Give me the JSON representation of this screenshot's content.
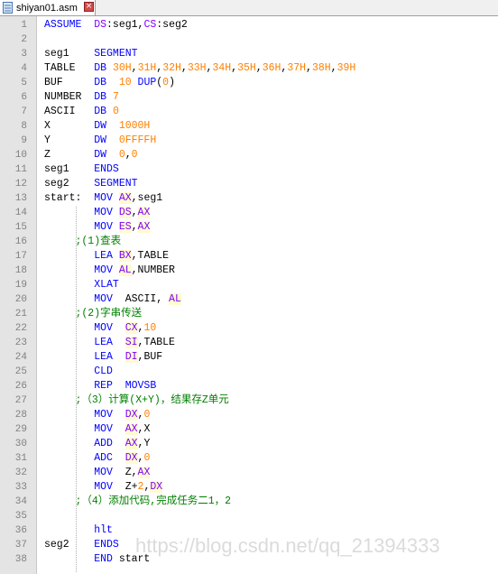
{
  "tab": {
    "filename": "shiyan01.asm",
    "close_glyph": "×"
  },
  "colors": {
    "keyword": "#0000ff",
    "register": "#8000ff",
    "number": "#ff8000",
    "comment": "#008000",
    "gutter": "#e4e4e4"
  },
  "lines": [
    [
      [
        "ASSUME  ",
        "kw"
      ],
      [
        "DS",
        "reg"
      ],
      [
        ":seg1,",
        ""
      ],
      [
        "CS",
        "reg"
      ],
      [
        ":seg2",
        ""
      ]
    ],
    [],
    [
      [
        "seg1    ",
        ""
      ],
      [
        "SEGMENT",
        "kw"
      ]
    ],
    [
      [
        "TABLE   ",
        ""
      ],
      [
        "DB ",
        "kw"
      ],
      [
        "30H",
        "num"
      ],
      [
        ",",
        ""
      ],
      [
        "31H",
        "num"
      ],
      [
        ",",
        ""
      ],
      [
        "32H",
        "num"
      ],
      [
        ",",
        ""
      ],
      [
        "33H",
        "num"
      ],
      [
        ",",
        ""
      ],
      [
        "34H",
        "num"
      ],
      [
        ",",
        ""
      ],
      [
        "35H",
        "num"
      ],
      [
        ",",
        ""
      ],
      [
        "36H",
        "num"
      ],
      [
        ",",
        ""
      ],
      [
        "37H",
        "num"
      ],
      [
        ",",
        ""
      ],
      [
        "38H",
        "num"
      ],
      [
        ",",
        ""
      ],
      [
        "39H",
        "num"
      ]
    ],
    [
      [
        "BUF     ",
        ""
      ],
      [
        "DB  ",
        "kw"
      ],
      [
        "10 ",
        "num"
      ],
      [
        "DUP",
        "kw"
      ],
      [
        "(",
        ""
      ],
      [
        "0",
        "num"
      ],
      [
        ")",
        ""
      ]
    ],
    [
      [
        "NUMBER  ",
        ""
      ],
      [
        "DB ",
        "kw"
      ],
      [
        "7",
        "num"
      ]
    ],
    [
      [
        "ASCII   ",
        ""
      ],
      [
        "DB ",
        "kw"
      ],
      [
        "0",
        "num"
      ]
    ],
    [
      [
        "X       ",
        ""
      ],
      [
        "DW  ",
        "kw"
      ],
      [
        "1000H",
        "num"
      ]
    ],
    [
      [
        "Y       ",
        ""
      ],
      [
        "DW  ",
        "kw"
      ],
      [
        "0FFFFH",
        "num"
      ]
    ],
    [
      [
        "Z       ",
        ""
      ],
      [
        "DW  ",
        "kw"
      ],
      [
        "0",
        "num"
      ],
      [
        ",",
        ""
      ],
      [
        "0",
        "num"
      ]
    ],
    [
      [
        "seg1    ",
        ""
      ],
      [
        "ENDS",
        "kw"
      ]
    ],
    [
      [
        "seg2    ",
        ""
      ],
      [
        "SEGMENT",
        "kw"
      ]
    ],
    [
      [
        "start:  ",
        ""
      ],
      [
        "MOV ",
        "kw"
      ],
      [
        "AX",
        "reg"
      ],
      [
        ",seg1",
        ""
      ]
    ],
    [
      [
        "        ",
        ""
      ],
      [
        "MOV ",
        "kw"
      ],
      [
        "DS",
        "reg"
      ],
      [
        ",",
        ""
      ],
      [
        "AX",
        "reg"
      ]
    ],
    [
      [
        "        ",
        ""
      ],
      [
        "MOV ",
        "kw"
      ],
      [
        "ES",
        "reg"
      ],
      [
        ",",
        ""
      ],
      [
        "AX",
        "reg"
      ]
    ],
    [
      [
        "     ;(1)查表",
        "cmt"
      ]
    ],
    [
      [
        "        ",
        ""
      ],
      [
        "LEA ",
        "kw"
      ],
      [
        "BX",
        "reg"
      ],
      [
        ",TABLE",
        ""
      ]
    ],
    [
      [
        "        ",
        ""
      ],
      [
        "MOV ",
        "kw"
      ],
      [
        "AL",
        "reg"
      ],
      [
        ",NUMBER",
        ""
      ]
    ],
    [
      [
        "        ",
        ""
      ],
      [
        "XLAT",
        "kw"
      ]
    ],
    [
      [
        "        ",
        ""
      ],
      [
        "MOV  ",
        "kw"
      ],
      [
        "ASCII, ",
        ""
      ],
      [
        "AL",
        "reg"
      ]
    ],
    [
      [
        "     ;(2)字串传送",
        "cmt"
      ]
    ],
    [
      [
        "        ",
        ""
      ],
      [
        "MOV  ",
        "kw"
      ],
      [
        "CX",
        "reg"
      ],
      [
        ",",
        ""
      ],
      [
        "10",
        "num"
      ]
    ],
    [
      [
        "        ",
        ""
      ],
      [
        "LEA  ",
        "kw"
      ],
      [
        "SI",
        "reg"
      ],
      [
        ",TABLE",
        ""
      ]
    ],
    [
      [
        "        ",
        ""
      ],
      [
        "LEA  ",
        "kw"
      ],
      [
        "DI",
        "reg"
      ],
      [
        ",BUF",
        ""
      ]
    ],
    [
      [
        "        ",
        ""
      ],
      [
        "CLD",
        "kw"
      ]
    ],
    [
      [
        "        ",
        ""
      ],
      [
        "REP  MOVSB",
        "kw"
      ]
    ],
    [
      [
        "     ;（3）计算(X+Y)，结果存Z单元",
        "cmt"
      ]
    ],
    [
      [
        "        ",
        ""
      ],
      [
        "MOV  ",
        "kw"
      ],
      [
        "DX",
        "reg"
      ],
      [
        ",",
        ""
      ],
      [
        "0",
        "num"
      ]
    ],
    [
      [
        "        ",
        ""
      ],
      [
        "MOV  ",
        "kw"
      ],
      [
        "AX",
        "reg"
      ],
      [
        ",X",
        ""
      ]
    ],
    [
      [
        "        ",
        ""
      ],
      [
        "ADD  ",
        "kw"
      ],
      [
        "AX",
        "reg"
      ],
      [
        ",Y",
        ""
      ]
    ],
    [
      [
        "        ",
        ""
      ],
      [
        "ADC  ",
        "kw"
      ],
      [
        "DX",
        "reg"
      ],
      [
        ",",
        ""
      ],
      [
        "0",
        "num"
      ]
    ],
    [
      [
        "        ",
        ""
      ],
      [
        "MOV  ",
        "kw"
      ],
      [
        "Z,",
        ""
      ],
      [
        "AX",
        "reg"
      ]
    ],
    [
      [
        "        ",
        ""
      ],
      [
        "MOV  ",
        "kw"
      ],
      [
        "Z+",
        ""
      ],
      [
        "2",
        "num"
      ],
      [
        ",",
        ""
      ],
      [
        "DX",
        "reg"
      ]
    ],
    [
      [
        "     ;（4）添加代码,完成任务二1，2",
        "cmt"
      ]
    ],
    [],
    [
      [
        "        ",
        ""
      ],
      [
        "hlt",
        "kw"
      ]
    ],
    [
      [
        "seg2    ",
        ""
      ],
      [
        "ENDS",
        "kw"
      ]
    ],
    [
      [
        "        ",
        ""
      ],
      [
        "END ",
        "kw"
      ],
      [
        "start",
        ""
      ]
    ]
  ],
  "watermark": "https://blog.csdn.net/qq_21394333"
}
